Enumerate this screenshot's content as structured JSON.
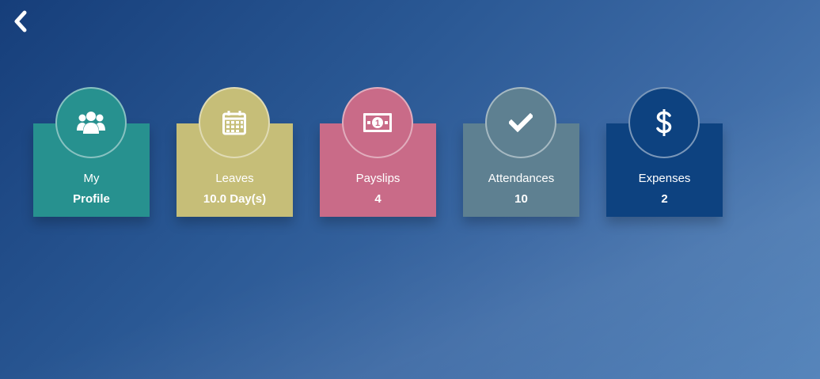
{
  "nav": {
    "back_icon": "chevron-left-icon"
  },
  "tiles": [
    {
      "label": "My",
      "value": "Profile",
      "icon": "users-icon",
      "color": "#27918f"
    },
    {
      "label": "Leaves",
      "value": "10.0 Day(s)",
      "icon": "calendar-icon",
      "color": "#c6be78"
    },
    {
      "label": "Payslips",
      "value": "4",
      "icon": "money-bill-icon",
      "color": "#c96b88"
    },
    {
      "label": "Attendances",
      "value": "10",
      "icon": "check-icon",
      "color": "#5e8091"
    },
    {
      "label": "Expenses",
      "value": "2",
      "icon": "dollar-icon",
      "color": "#0d4280"
    }
  ]
}
